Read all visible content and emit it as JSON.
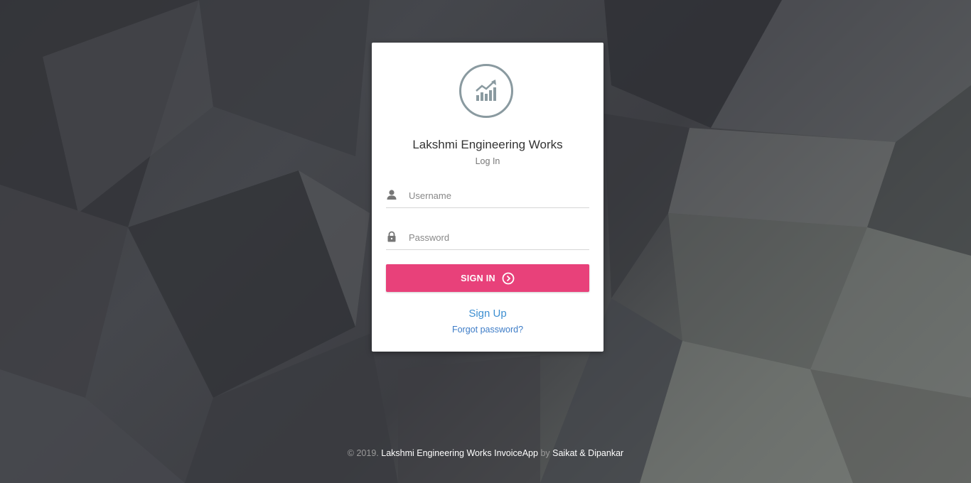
{
  "brand": {
    "title": "Lakshmi Engineering Works",
    "subtitle": "Log In",
    "logo_icon": "chart-growth-icon"
  },
  "form": {
    "username_placeholder": "Username",
    "username_value": "",
    "username_icon": "user-icon",
    "password_placeholder": "Password",
    "password_value": "",
    "password_icon": "lock-icon",
    "signin_label": "SIGN IN",
    "signin_icon": "arrow-circle-right-icon"
  },
  "links": {
    "signup": "Sign Up",
    "forgot": "Forgot password?"
  },
  "footer": {
    "copyright": "© 2019.",
    "app_name": "Lakshmi Engineering Works InvoiceApp",
    "by": "by",
    "authors": "Saikat & Dipankar"
  },
  "colors": {
    "accent": "#e8417a",
    "link": "#3d8fd1",
    "logo_stroke": "#8a9aa0"
  }
}
